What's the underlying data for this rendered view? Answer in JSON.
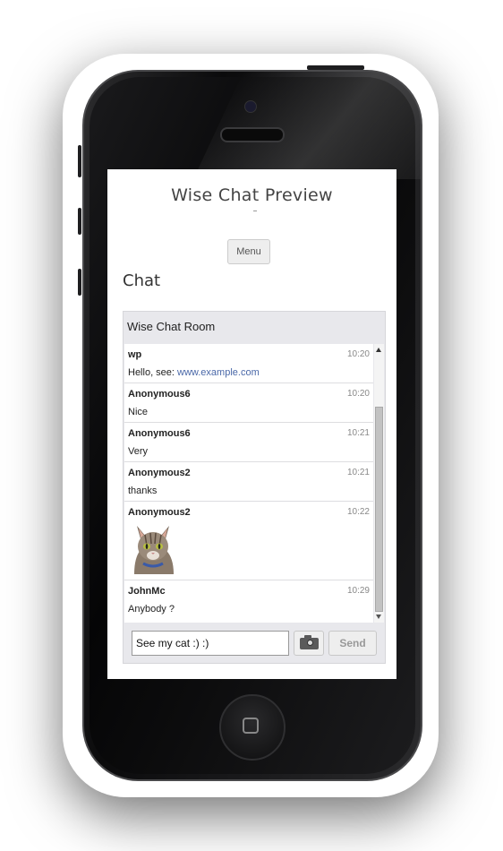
{
  "page": {
    "site_title": "Wise Chat Preview",
    "tagline": "-"
  },
  "nav": {
    "menu_label": "Menu"
  },
  "content": {
    "heading": "Chat"
  },
  "chat": {
    "room_name": "Wise Chat Room",
    "messages": [
      {
        "user": "wp",
        "time": "10:20",
        "text_prefix": "Hello, see: ",
        "link": "www.example.com"
      },
      {
        "user": "Anonymous6",
        "time": "10:20",
        "text": "Nice"
      },
      {
        "user": "Anonymous6",
        "time": "10:21",
        "text": "Very"
      },
      {
        "user": "Anonymous2",
        "time": "10:21",
        "text": "thanks"
      },
      {
        "user": "Anonymous2",
        "time": "10:22",
        "image": "cat-photo"
      },
      {
        "user": "JohnMc",
        "time": "10:29",
        "text": "Anybody ?"
      }
    ],
    "input_value": "See my cat :) :)",
    "send_label": "Send",
    "attach_icon": "camera-icon"
  },
  "colors": {
    "link": "#4a68a8",
    "chat_bg": "#e8e8ec"
  }
}
